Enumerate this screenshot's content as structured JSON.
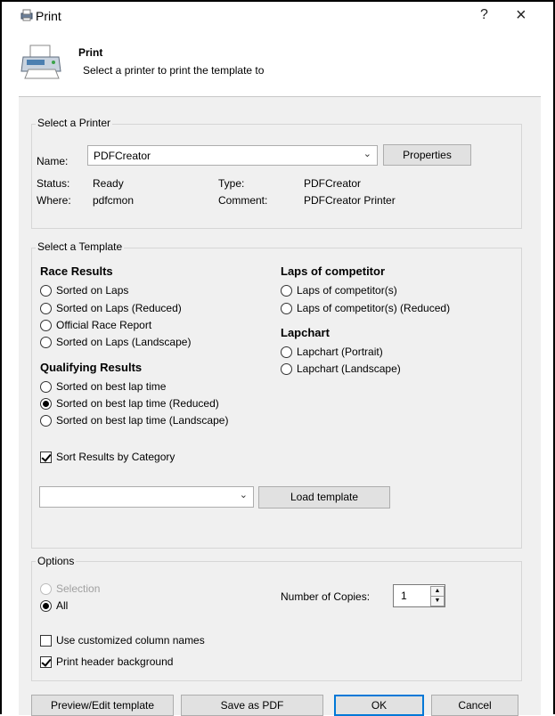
{
  "window": {
    "title": "Print",
    "help": "?",
    "close": "×"
  },
  "header": {
    "title": "Print",
    "subtitle": "Select a printer to print the template to"
  },
  "printer_group": {
    "title": "Select a Printer",
    "name_label": "Name:",
    "name_value": "PDFCreator",
    "properties_label": "Properties",
    "status_label": "Status:",
    "status_value": "Ready",
    "type_label": "Type:",
    "type_value": "PDFCreator",
    "where_label": "Where:",
    "where_value": "pdfcmon",
    "comment_label": "Comment:",
    "comment_value": "PDFCreator Printer"
  },
  "template_group": {
    "title": "Select a Template",
    "race_results": {
      "heading": "Race Results",
      "options": [
        "Sorted on Laps",
        "Sorted on Laps (Reduced)",
        "Official Race Report",
        "Sorted on Laps (Landscape)"
      ]
    },
    "qualifying_results": {
      "heading": "Qualifying Results",
      "options": [
        "Sorted on best lap time",
        "Sorted on best lap time (Reduced)",
        "Sorted on best lap time (Landscape)"
      ]
    },
    "laps_of_competitor": {
      "heading": "Laps of competitor",
      "options": [
        "Laps of competitor(s)",
        "Laps of competitor(s) (Reduced)"
      ]
    },
    "lapchart": {
      "heading": "Lapchart",
      "options": [
        "Lapchart (Portrait)",
        "Lapchart (Landscape)"
      ]
    },
    "selected": "Sorted on best lap time (Reduced)",
    "sort_by_category_label": "Sort Results by Category",
    "sort_by_category_checked": true,
    "template_combo_value": "",
    "load_template_label": "Load template"
  },
  "options_group": {
    "title": "Options",
    "selection_label": "Selection",
    "all_label": "All",
    "copies_label": "Number of Copies:",
    "copies_value": "1",
    "custom_columns_label": "Use customized column names",
    "custom_columns_checked": false,
    "header_bg_label": "Print header background",
    "header_bg_checked": true
  },
  "footer": {
    "preview_label": "Preview/Edit template",
    "save_pdf_label": "Save as PDF",
    "ok_label": "OK",
    "cancel_label": "Cancel"
  }
}
